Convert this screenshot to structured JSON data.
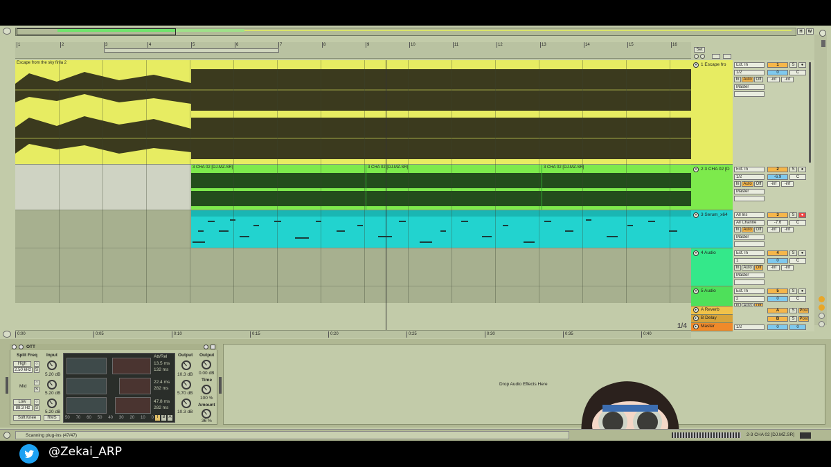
{
  "overview": {
    "hw_buttons": [
      "H",
      "W"
    ]
  },
  "ruler": {
    "bars": [
      "1",
      "2",
      "3",
      "4",
      "5",
      "6",
      "7",
      "8",
      "9",
      "10",
      "11",
      "12",
      "13",
      "14",
      "15",
      "16"
    ],
    "set_label": "Set"
  },
  "tracks": [
    {
      "number": "1",
      "name": "1 Escape fro",
      "clip_title": "Escape from the sky finla 2",
      "color": "#e7ec62",
      "input": "Ext. In",
      "channel": "1/2",
      "monitor": [
        "In",
        "Auto",
        "Off"
      ],
      "output": "Master",
      "volume": "0",
      "pan": "C",
      "sends": [
        "-inf",
        "-inf"
      ]
    },
    {
      "number": "2",
      "name": "2 3 CHA 02 [D",
      "clip_titles": [
        "3 CHA 02 [DJ.MZ.SR]",
        "3 CHA 02 [DJ.MZ.SR]",
        "3 CHA 02 [DJ.MZ.SR]"
      ],
      "color": "#7dea4c",
      "input": "Ext. In",
      "channel": "1/2",
      "monitor": [
        "In",
        "Auto",
        "Off"
      ],
      "output": "Master",
      "volume": "-6.9",
      "pan": "C",
      "sends": [
        "-inf",
        "-inf"
      ]
    },
    {
      "number": "3",
      "name": "3 Serum_x64",
      "color": "#22d3cf",
      "input": "All Ins",
      "channel": "All Channe",
      "monitor": [
        "In",
        "Auto",
        "Off"
      ],
      "output": "Master",
      "volume": "-7.6",
      "pan": "C",
      "sends": [
        "-inf",
        "-inf"
      ]
    },
    {
      "number": "4",
      "name": "4 Audio",
      "color": "#34e88a",
      "input": "Ext. In",
      "channel": "1",
      "monitor": [
        "In",
        "Auto",
        "Off"
      ],
      "output": "Master",
      "volume": "0",
      "pan": "C",
      "sends": [
        "-inf",
        "-inf"
      ]
    },
    {
      "number": "5",
      "name": "5 Audio",
      "color": "#4ee05a",
      "input": "Ext. In",
      "channel": "2",
      "monitor": [
        "In",
        "Auto",
        "Off"
      ],
      "volume": "0",
      "pan": "C"
    }
  ],
  "returns": [
    {
      "letter": "A",
      "name": "A Reverb",
      "post": "Post"
    },
    {
      "letter": "B",
      "name": "B Delay",
      "post": "Post"
    }
  ],
  "master": {
    "name": "Master",
    "channel": "1/2",
    "volume": "0",
    "pan": "0"
  },
  "solo_label": "S",
  "zoom_label": "1/4",
  "timeline": [
    "0:00",
    "0:05",
    "0:10",
    "0:15",
    "0:20",
    "0:25",
    "0:30",
    "0:35",
    "0:40"
  ],
  "ott": {
    "title": "OTT",
    "split_freq": "Split Freq",
    "input_label": "Input",
    "output_label": "Output",
    "high": "High",
    "high_freq": "2.50 kHz",
    "mid": "Mid",
    "low": "Low",
    "low_freq": "88.3 Hz",
    "soft_knee": "Soft Knee",
    "rms": "RMS",
    "inputs": [
      "5.20 dB",
      "5.20 dB",
      "5.20 dB"
    ],
    "outputs": [
      "10.3 dB",
      "5.70 dB",
      "10.3 dB"
    ],
    "att_rel_label": "Att/Rel",
    "att_rel": [
      [
        "13.5 ms",
        "132 ms"
      ],
      [
        "22.4 ms",
        "282 ms"
      ],
      [
        "47.8 ms",
        "282 ms"
      ]
    ],
    "scale": [
      "50",
      "70",
      "60",
      "50",
      "40",
      "30",
      "20",
      "10",
      "0"
    ],
    "band_toggles": [
      "T",
      "B",
      "A"
    ],
    "master_output_label": "Output",
    "master_output": "0.00 dB",
    "time_label": "Time",
    "time": "100 %",
    "amount_label": "Amount",
    "amount": "36 %"
  },
  "drop_zone": "Drop Audio Effects Here",
  "status": {
    "text": "Scanning plug-ins (47/47)",
    "selected_clip": "2-3 CHA 02 [DJ.MZ.SR]"
  },
  "footer": {
    "handle": "@Zekai_ARP"
  },
  "colors": {
    "accent_orange": "#f5b64a",
    "blue": "#7fc9ee",
    "bg": "#c2cba9"
  }
}
